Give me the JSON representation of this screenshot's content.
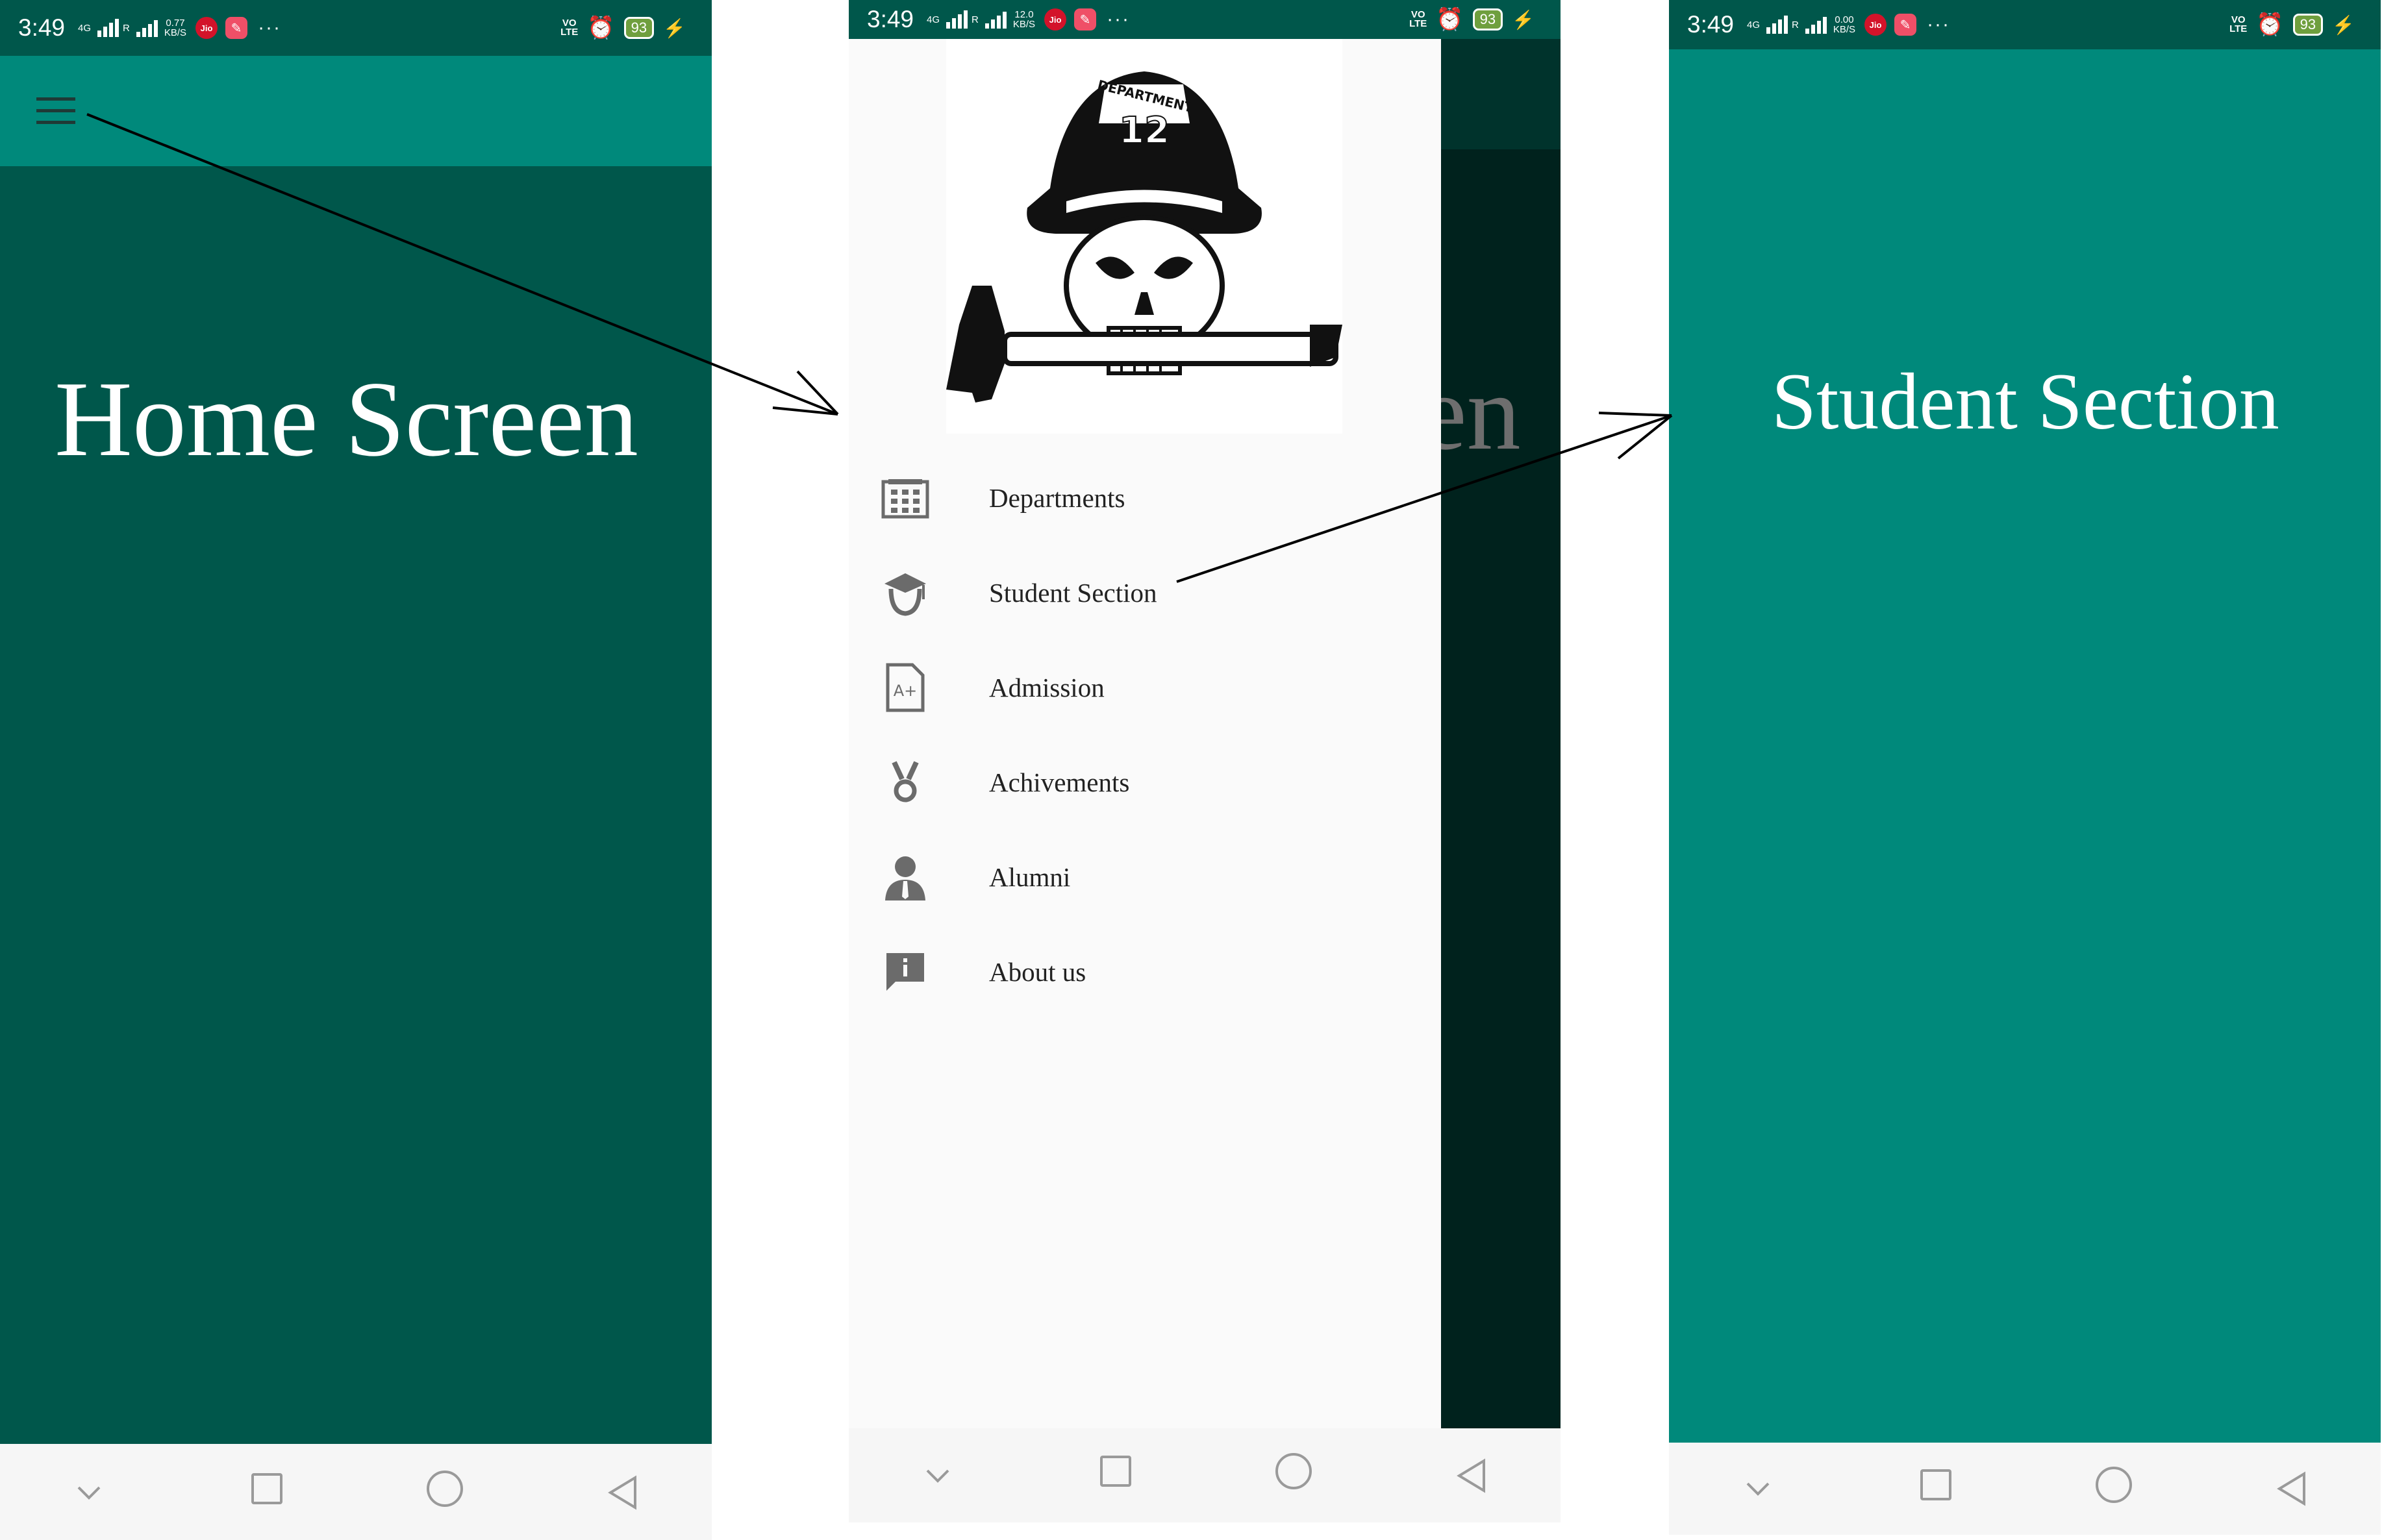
{
  "statusbar": {
    "time": "3:49",
    "net_left": "4G",
    "roaming": "R",
    "battery": "93",
    "volte": "VO\nLTE",
    "jio": "Jio",
    "more": "···"
  },
  "screens": {
    "home": {
      "speed_top": "0.77",
      "speed_unit": "KB/S",
      "heading": "Home Screen",
      "menu_icon": "hamburger-menu-icon"
    },
    "drawer": {
      "speed_top": "12.0",
      "speed_unit": "KB/S",
      "underlay_text": "en",
      "items": [
        {
          "label": "Departments",
          "icon": "building-icon"
        },
        {
          "label": "Student Section",
          "icon": "graduation-cap-icon"
        },
        {
          "label": "Admission",
          "icon": "grade-document-icon"
        },
        {
          "label": "Achivements",
          "icon": "medal-icon"
        },
        {
          "label": "Alumni",
          "icon": "person-icon"
        },
        {
          "label": "About us",
          "icon": "info-message-icon"
        }
      ],
      "logo_helmet_text_top": "DEPARTMENT",
      "logo_helmet_number": "12"
    },
    "student": {
      "speed_top": "0.00",
      "speed_unit": "KB/S",
      "heading": "Student Section"
    }
  },
  "colors": {
    "home_toolbar": "#00897b",
    "home_body": "#00574b",
    "status_home": "#00574b",
    "drawer_bg": "#fafafa",
    "scrim_teal": "#004d40",
    "student_body": "#00897b",
    "student_status": "#00574b",
    "icon_grey": "#6b6b6b"
  }
}
